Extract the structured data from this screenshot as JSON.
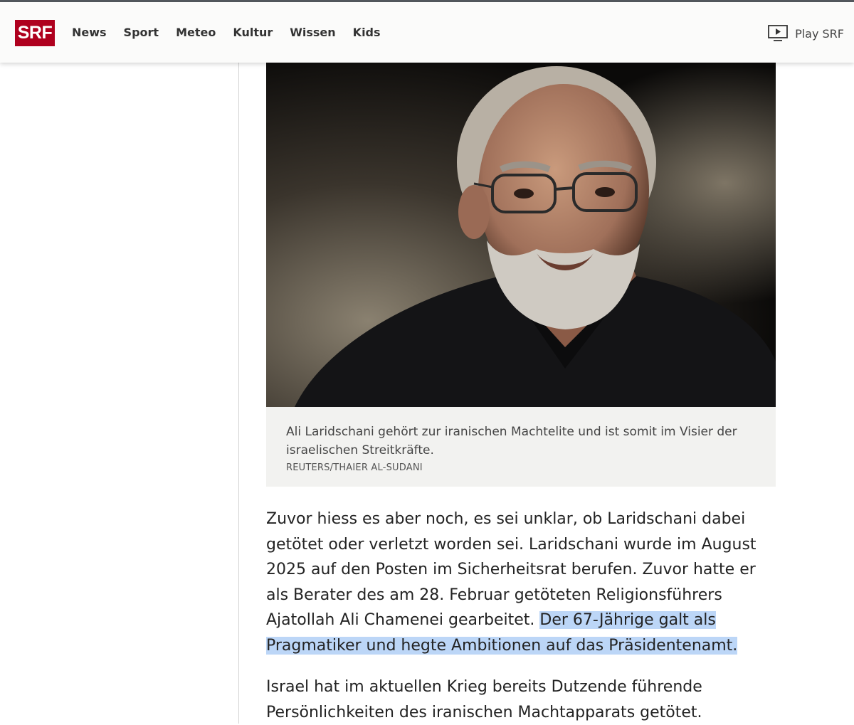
{
  "header": {
    "logo": "SRF",
    "nav": [
      "News",
      "Sport",
      "Meteo",
      "Kultur",
      "Wissen",
      "Kids"
    ],
    "play_label": "Play SRF"
  },
  "figure": {
    "caption": "Ali Laridschani gehört zur iranischen Machtelite und ist somit im Visier der israelischen Streitkräfte.",
    "credit": "REUTERS/THAIER AL-SUDANI"
  },
  "article": {
    "p1_text": "Zuvor hiess es aber noch, es sei unklar, ob Laridschani dabei getötet oder verletzt worden sei. Laridschani wurde im August 2025 auf den Posten im Sicherheitsrat berufen. Zuvor hatte er als Berater des am 28. Februar getöteten Religionsführers Ajatollah Ali Chamenei gearbeitet. ",
    "p1_highlight": "Der 67-Jährige galt als Pragmatiker und hegte Ambitionen auf das Präsidentenamt.",
    "p2_text": "Israel hat im aktuellen Krieg bereits Dutzende führende Persönlichkeiten des iranischen Machtapparats getötet."
  },
  "colors": {
    "brand": "#af001e",
    "highlight": "#bcd6f7",
    "caption_bg": "#f2f2f0"
  }
}
